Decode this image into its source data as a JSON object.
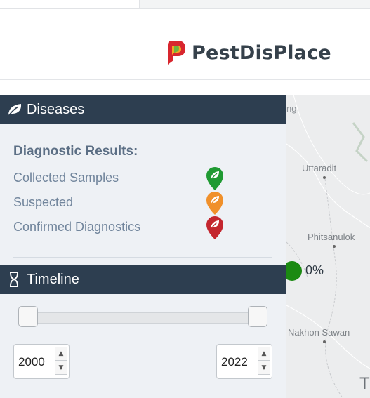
{
  "header": {
    "brand": "PestDisPlace"
  },
  "diseases_panel": {
    "title": "Diseases",
    "results_title": "Diagnostic Results:",
    "legend": [
      {
        "label": "Collected Samples",
        "color": "#1f9a32",
        "icon": "leaf-pin-icon"
      },
      {
        "label": "Suspected",
        "color": "#f0902a",
        "icon": "leaf-pin-icon"
      },
      {
        "label": "Confirmed Diagnostics",
        "color": "#c4262e",
        "icon": "leaf-pin-icon"
      }
    ]
  },
  "timeline_panel": {
    "title": "Timeline",
    "start_year": "2000",
    "end_year": "2022"
  },
  "map": {
    "places": [
      "Uttaradit",
      "Phitsanulok",
      "Nakhon Sawan"
    ],
    "marker_color": "#1b8a12",
    "marker_percent": "0%",
    "fragment_top": "ng",
    "fragment_bottom": "T"
  }
}
